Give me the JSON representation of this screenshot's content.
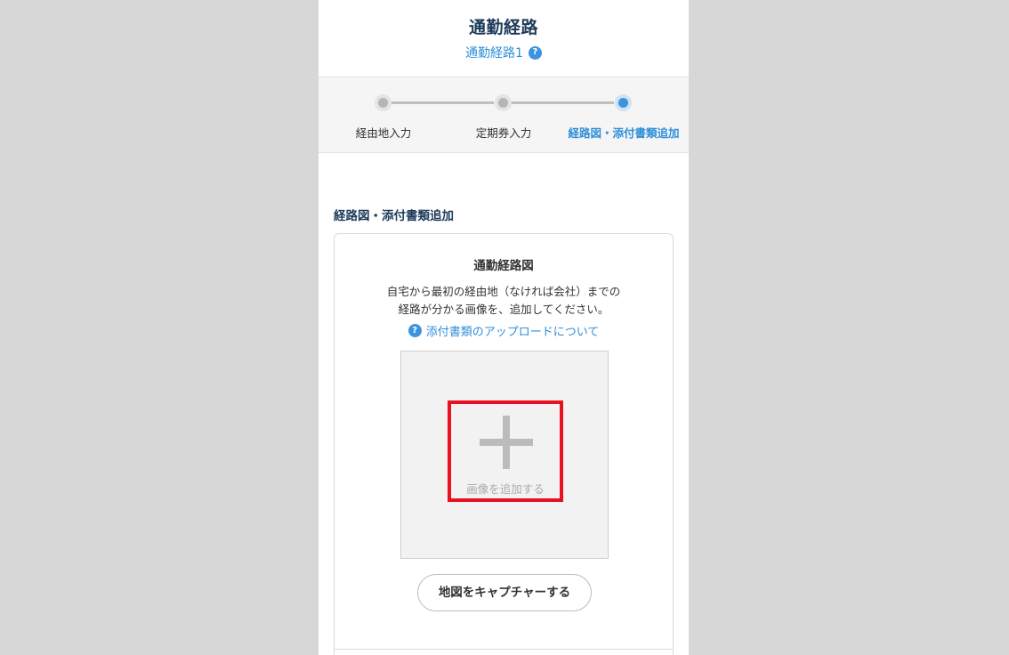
{
  "header": {
    "title": "通勤経路",
    "subtitle": "通勤経路1",
    "help_icon": "question-circle-icon"
  },
  "stepper": {
    "steps": [
      {
        "label": "経由地入力",
        "state": "done"
      },
      {
        "label": "定期券入力",
        "state": "done"
      },
      {
        "label": "経路図・添付書類追加",
        "state": "active"
      }
    ]
  },
  "section": {
    "title": "経路図・添付書類追加"
  },
  "route_card": {
    "title": "通勤経路図",
    "description_line1": "自宅から最初の経由地（なければ会社）までの",
    "description_line2": "経路が分かる画像を、追加してください。",
    "help_link": "添付書類のアップロードについて",
    "add_image_label": "画像を追加する",
    "add_icon": "plus-icon",
    "capture_button": "地図をキャプチャーする"
  },
  "colors": {
    "accent": "#3d93dd",
    "title": "#1d3a5a",
    "highlight": "#e8111f",
    "background": "#d7d7d7"
  }
}
